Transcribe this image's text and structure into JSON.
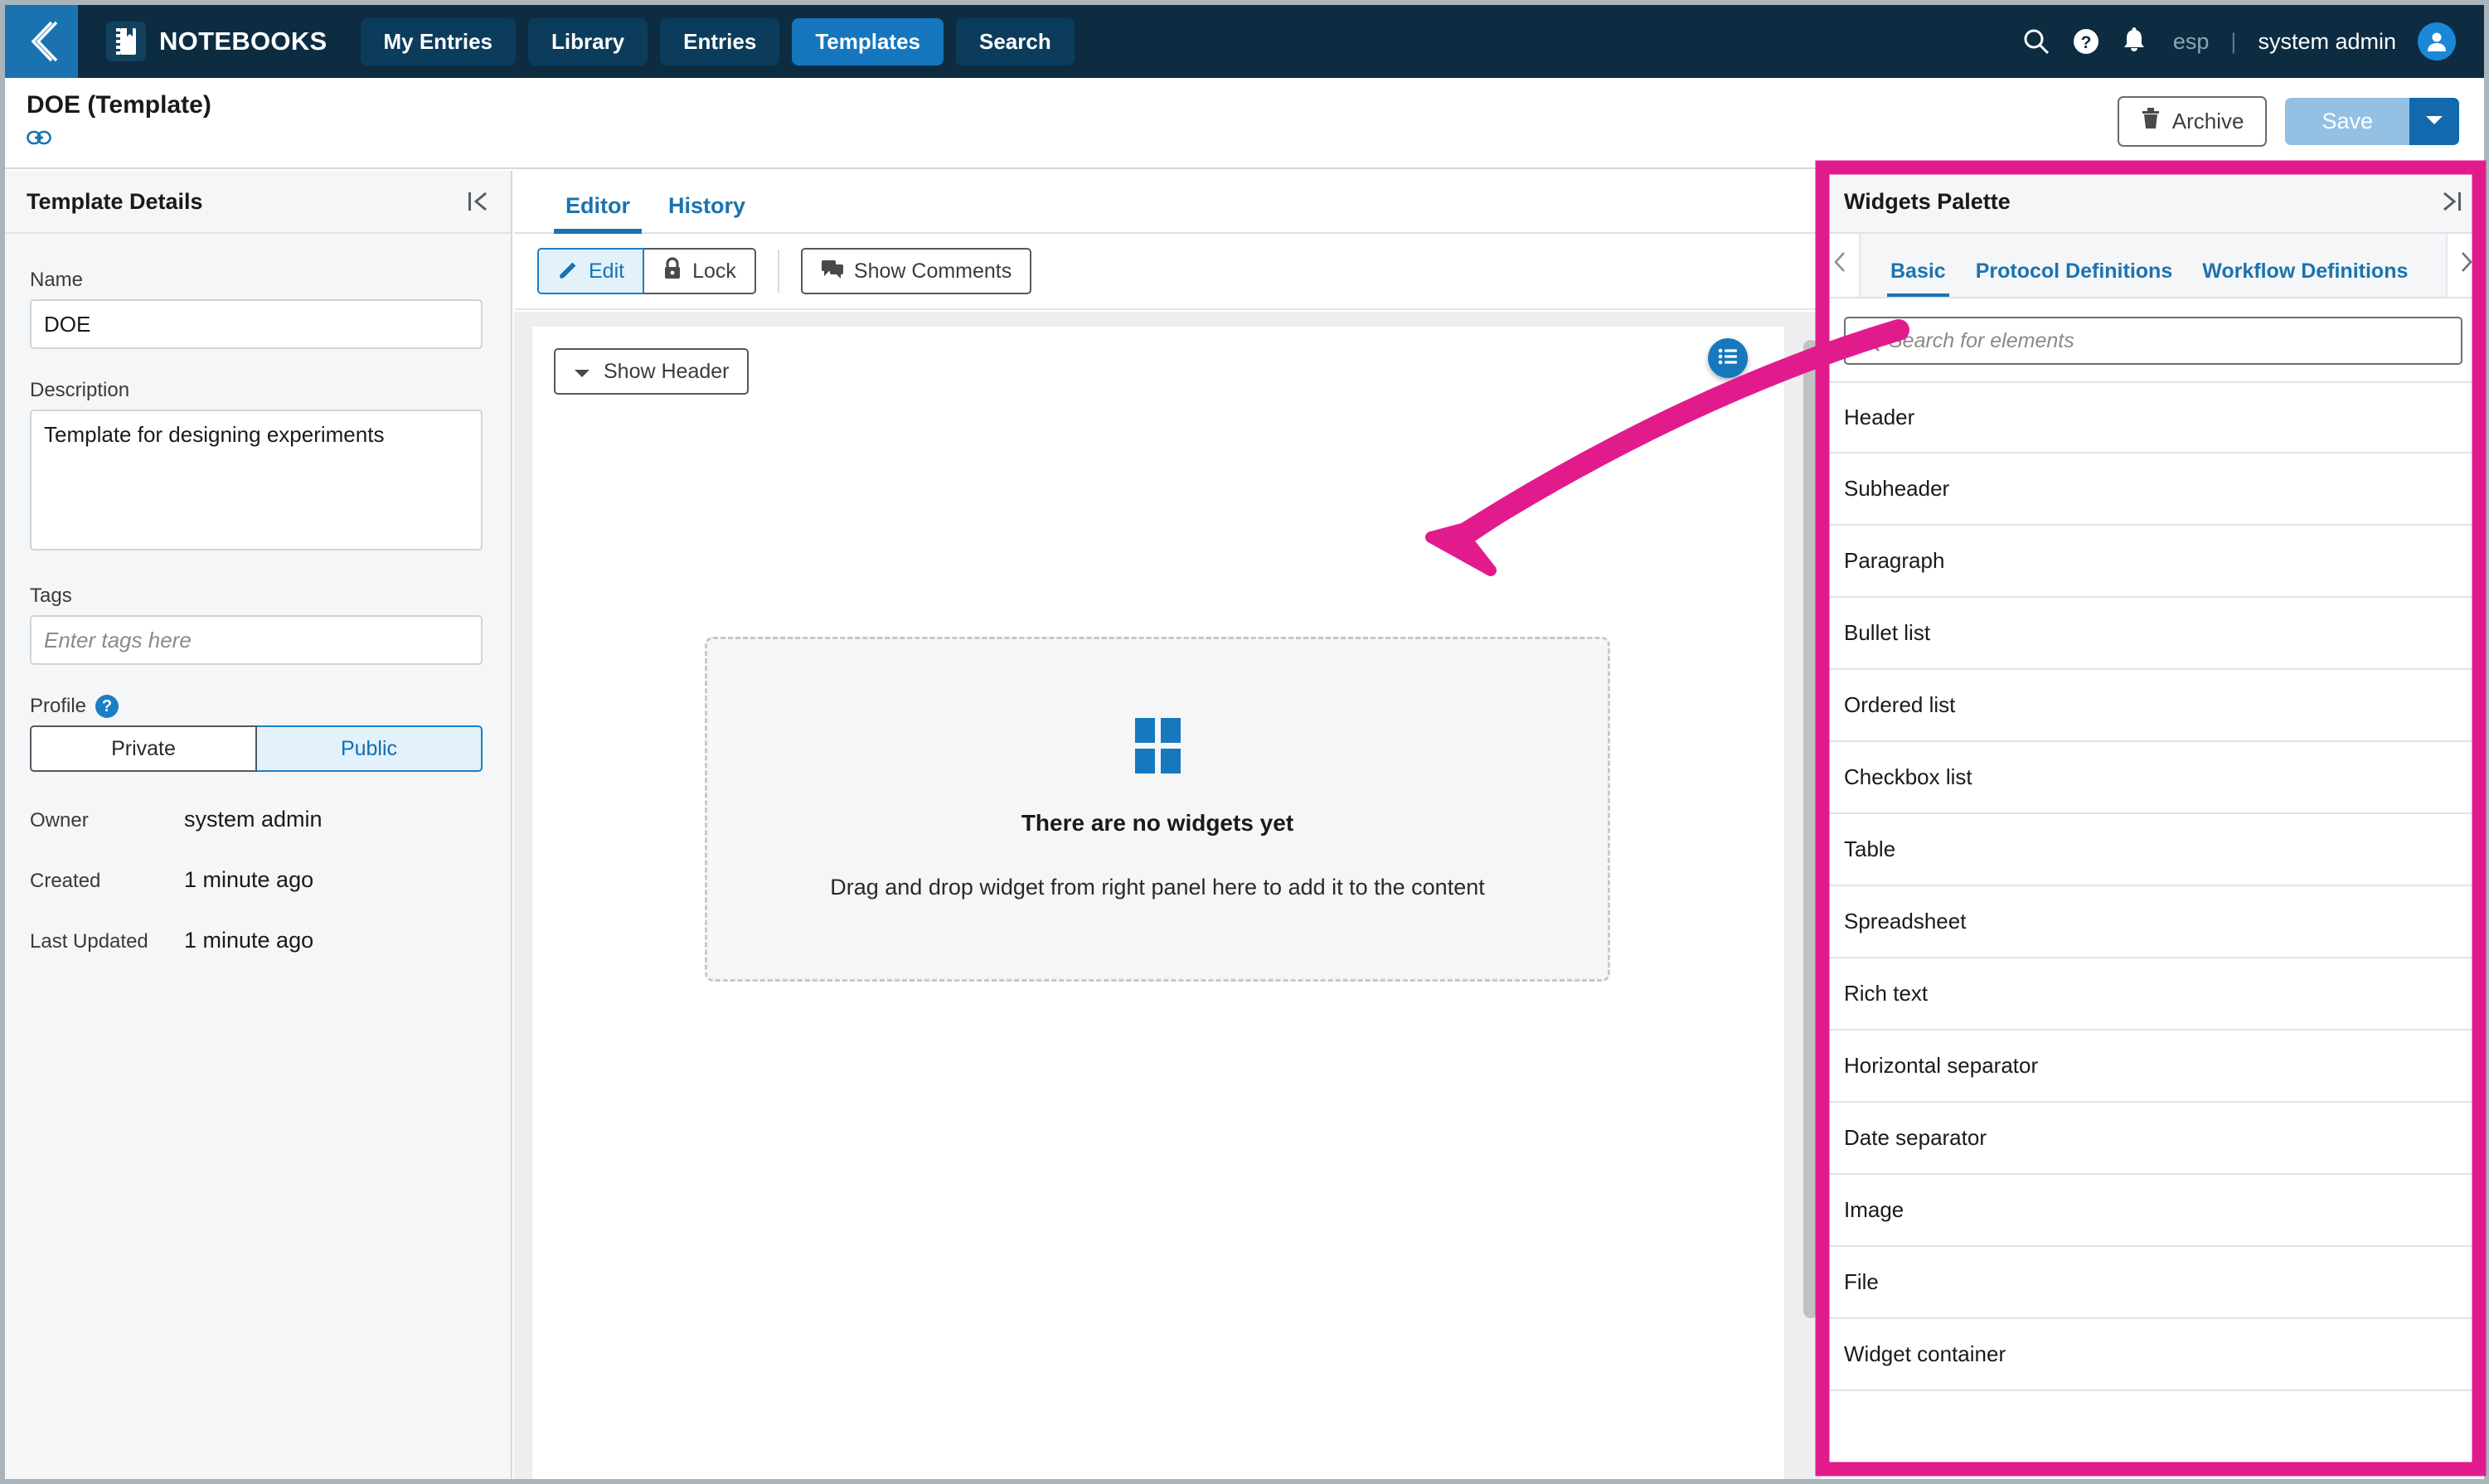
{
  "topnav": {
    "back_icon": "chevron-left-icon",
    "brand_icon": "notebook-icon",
    "brand": "NOTEBOOKS",
    "tabs": [
      {
        "label": "My Entries",
        "active": false
      },
      {
        "label": "Library",
        "active": false
      },
      {
        "label": "Entries",
        "active": false
      },
      {
        "label": "Templates",
        "active": true
      },
      {
        "label": "Search",
        "active": false
      }
    ],
    "search_icon": "search-icon",
    "help_icon": "help-circle-icon",
    "bell_icon": "notification-bell-icon",
    "locale": "esp",
    "separator": "|",
    "user": "system admin",
    "avatar_icon": "user-avatar-icon"
  },
  "titlebar": {
    "title": "DOE (Template)",
    "link_icon": "link-icon",
    "archive_label": "Archive",
    "archive_icon": "trash-icon",
    "save_label": "Save",
    "save_caret_icon": "chevron-down-icon"
  },
  "left_panel": {
    "title": "Template Details",
    "collapse_icon": "collapse-left-icon",
    "name_label": "Name",
    "name_value": "DOE",
    "name_placeholder": "",
    "description_label": "Description",
    "description_value": "Template for designing experiments",
    "tags_label": "Tags",
    "tags_value": "",
    "tags_placeholder": "Enter tags here",
    "profile_label": "Profile",
    "profile_help_icon": "help-circle-icon",
    "profile_options": [
      "Private",
      "Public"
    ],
    "profile_selected": "Public",
    "meta": [
      {
        "key": "Owner",
        "value": "system admin"
      },
      {
        "key": "Created",
        "value": "1 minute ago"
      },
      {
        "key": "Last Updated",
        "value": "1 minute ago"
      }
    ]
  },
  "center": {
    "tabs": [
      {
        "label": "Editor",
        "active": true
      },
      {
        "label": "History",
        "active": false
      }
    ],
    "edit_label": "Edit",
    "edit_icon": "pencil-icon",
    "lock_label": "Lock",
    "lock_icon": "lock-icon",
    "comments_label": "Show Comments",
    "comments_icon": "comment-icon",
    "show_header_label": "Show Header",
    "show_header_icon": "caret-down-icon",
    "list_fab_icon": "list-icon",
    "empty_title": "There are no widgets yet",
    "empty_sub": "Drag and drop widget from right panel here to add it to the content",
    "empty_icon": "widgets-grid-icon"
  },
  "right_panel": {
    "title": "Widgets Palette",
    "expand_icon": "expand-right-icon",
    "prev_icon": "chevron-left-icon",
    "next_icon": "chevron-right-icon",
    "tabs": [
      {
        "label": "Basic",
        "active": true
      },
      {
        "label": "Protocol Definitions",
        "active": false
      },
      {
        "label": "Workflow Definitions",
        "active": false
      }
    ],
    "search_icon": "search-icon",
    "search_value": "",
    "search_placeholder": "Search for elements",
    "widgets": [
      "Header",
      "Subheader",
      "Paragraph",
      "Bullet list",
      "Ordered list",
      "Checkbox list",
      "Table",
      "Spreadsheet",
      "Rich text",
      "Horizontal separator",
      "Date separator",
      "Image",
      "File",
      "Widget container"
    ]
  },
  "annotation": {
    "highlight_color": "#e21b8d",
    "arrow_color": "#e21b8d",
    "highlight_target": "right_panel",
    "arrow_target": "drop-zone"
  },
  "colors": {
    "nav_bg": "#0d2c42",
    "nav_tab": "#0c3c5c",
    "nav_tab_active": "#1576bd",
    "accent_blue": "#1a73b0",
    "panel_bg": "#f5f6f7",
    "editor_bg": "#eeeef0",
    "annotation_pink": "#e21b8d"
  }
}
